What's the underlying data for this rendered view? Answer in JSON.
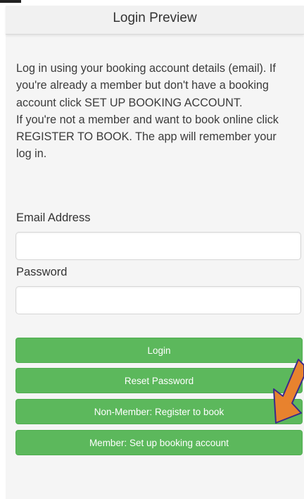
{
  "header": {
    "title": "Login Preview"
  },
  "intro": {
    "line1": "Log in using your booking account details (email). If you're already a member but don't have a booking account click SET UP BOOKING ACCOUNT.",
    "line2": "If you're not a member and want to book online click REGISTER TO BOOK. The app will remember your log in."
  },
  "form": {
    "email_label": "Email Address",
    "email_value": "",
    "password_label": "Password",
    "password_value": ""
  },
  "buttons": {
    "login": "Login",
    "reset": "Reset Password",
    "register": "Non-Member: Register to book",
    "setup": "Member: Set up booking account"
  },
  "colors": {
    "button_green": "#5cb85c",
    "arrow_orange": "#e8822e"
  },
  "icons": {
    "annotation": "orange-arrow-icon"
  }
}
